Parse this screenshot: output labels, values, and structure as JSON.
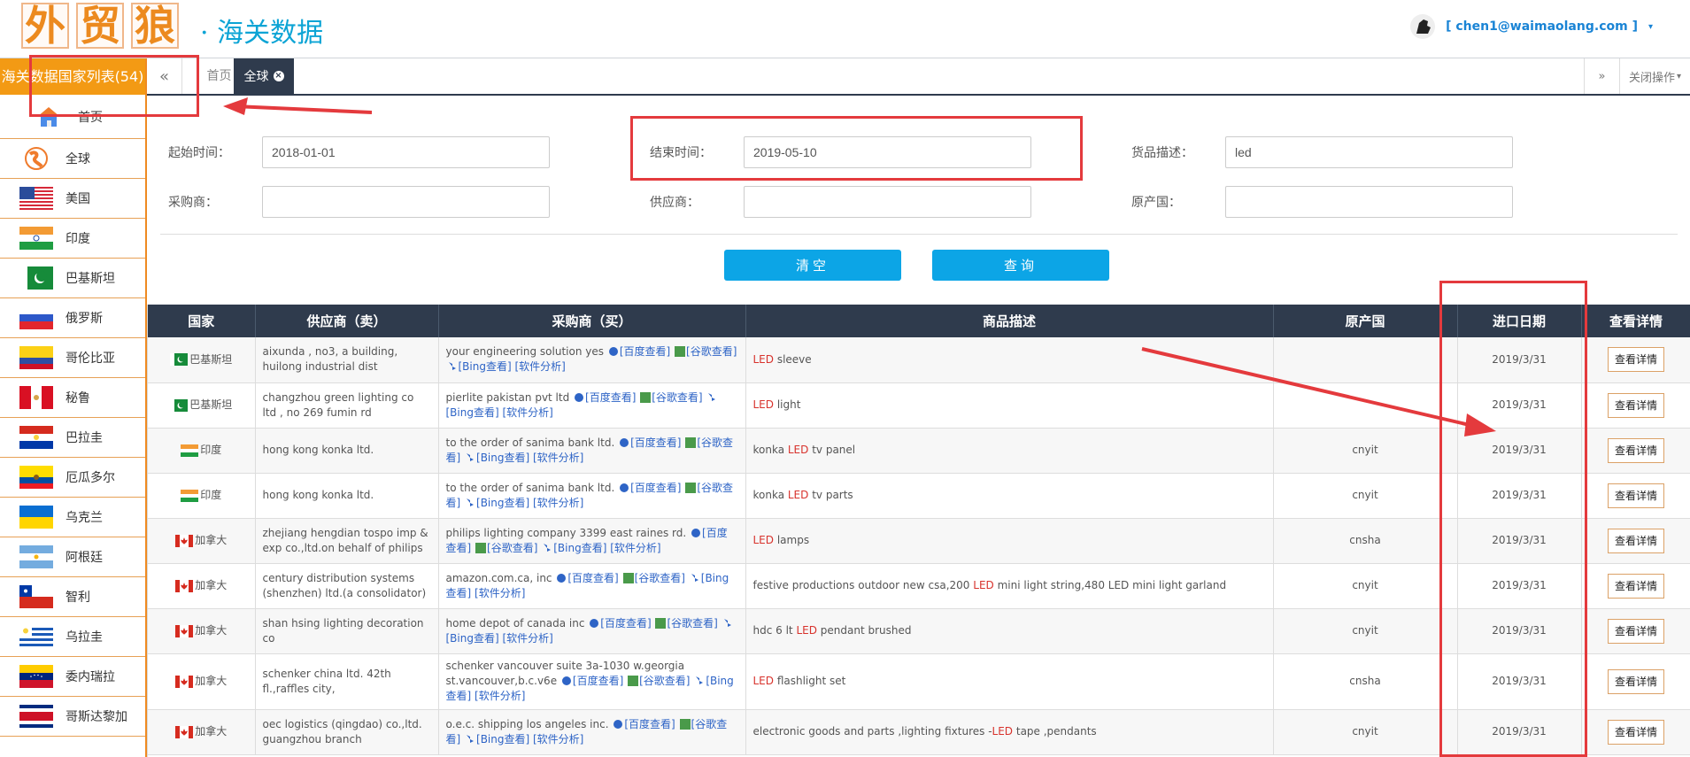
{
  "header": {
    "logo_chars": [
      "外",
      "贸",
      "狼"
    ],
    "brand": "· 海关数据",
    "user": "[ chen1@waimaolang.com ]"
  },
  "sidebar": {
    "title": "海关数据国家列表(54)",
    "home": "首页",
    "items": [
      {
        "label": "全球",
        "icon": "globe-icon"
      },
      {
        "label": "美国",
        "icon": "flag-usa-icon"
      },
      {
        "label": "印度",
        "icon": "flag-india-icon"
      },
      {
        "label": "巴基斯坦",
        "icon": "flag-pakistan-icon"
      },
      {
        "label": "俄罗斯",
        "icon": "flag-russia-icon"
      },
      {
        "label": "哥伦比亚",
        "icon": "flag-colombia-icon"
      },
      {
        "label": "秘鲁",
        "icon": "flag-peru-icon"
      },
      {
        "label": "巴拉圭",
        "icon": "flag-paraguay-icon"
      },
      {
        "label": "厄瓜多尔",
        "icon": "flag-ecuador-icon"
      },
      {
        "label": "乌克兰",
        "icon": "flag-ukraine-icon"
      },
      {
        "label": "阿根廷",
        "icon": "flag-argentina-icon"
      },
      {
        "label": "智利",
        "icon": "flag-chile-icon"
      },
      {
        "label": "乌拉圭",
        "icon": "flag-uruguay-icon"
      },
      {
        "label": "委内瑞拉",
        "icon": "flag-venezuela-icon"
      },
      {
        "label": "哥斯达黎加",
        "icon": "flag-costa-rica-icon"
      }
    ]
  },
  "tabs": {
    "home": "首页",
    "global": "全球",
    "close_ops": "关闭操作"
  },
  "form": {
    "start_label": "起始时间：",
    "start_value": "2018-01-01",
    "end_label": "结束时间：",
    "end_value": "2019-05-10",
    "desc_label": "货品描述：",
    "desc_value": "led",
    "buyer_label": "采购商：",
    "supplier_label": "供应商：",
    "origin_label": "原产国：",
    "clear": "清空",
    "search": "查询"
  },
  "table": {
    "headers": [
      "国家",
      "供应商（卖）",
      "采购商（买）",
      "商品描述",
      "原产国",
      "进口日期",
      "查看详情"
    ],
    "rows": [
      {
        "country": "巴基斯坦",
        "flag": "pk",
        "supplier": "aixunda , no3, a building, huilong industrial dist",
        "buyer": "your engineering solution yes",
        "desc_pre": "",
        "desc_led": "LED",
        "desc_post": " sleeve",
        "origin": "",
        "date": "2019/3/31"
      },
      {
        "country": "巴基斯坦",
        "flag": "pk",
        "supplier": "changzhou green lighting co ltd , no 269 fumin rd",
        "buyer": "pierlite pakistan pvt ltd",
        "desc_pre": "",
        "desc_led": "LED",
        "desc_post": " light",
        "origin": "",
        "date": "2019/3/31"
      },
      {
        "country": "印度",
        "flag": "in",
        "supplier": "hong kong konka ltd.",
        "buyer": "to the order of sanima bank ltd.",
        "desc_pre": "konka ",
        "desc_led": "LED",
        "desc_post": " tv panel",
        "origin": "cnyit",
        "date": "2019/3/31"
      },
      {
        "country": "印度",
        "flag": "in",
        "supplier": "hong kong konka ltd.",
        "buyer": "to the order of sanima bank ltd.",
        "desc_pre": "konka ",
        "desc_led": "LED",
        "desc_post": " tv parts",
        "origin": "cnyit",
        "date": "2019/3/31"
      },
      {
        "country": "加拿大",
        "flag": "ca",
        "supplier": "zhejiang hengdian tospo imp & exp co.,ltd.on behalf of philips",
        "buyer": "philips lighting company 3399 east raines rd.",
        "desc_pre": "",
        "desc_led": "LED",
        "desc_post": " lamps",
        "origin": "cnsha",
        "date": "2019/3/31"
      },
      {
        "country": "加拿大",
        "flag": "ca",
        "supplier": "century distribution systems (shenzhen) ltd.(a consolidator)",
        "buyer": "amazon.com.ca, inc",
        "desc_pre": "festive productions outdoor new csa,200 ",
        "desc_led": "LED",
        "desc_post": " mini light string,480 LED mini light garland",
        "origin": "cnyit",
        "date": "2019/3/31"
      },
      {
        "country": "加拿大",
        "flag": "ca",
        "supplier": "shan hsing lighting decoration co",
        "buyer": "home depot of canada inc",
        "desc_pre": "hdc 6 lt ",
        "desc_led": "LED",
        "desc_post": " pendant brushed",
        "origin": "cnyit",
        "date": "2019/3/31"
      },
      {
        "country": "加拿大",
        "flag": "ca",
        "supplier": "schenker china ltd. 42th fl.,raffles city,",
        "buyer": "schenker vancouver suite 3a-1030 w.georgia st.vancouver,b.c.v6e",
        "desc_pre": "",
        "desc_led": "LED",
        "desc_post": " flashlight set",
        "origin": "cnsha",
        "date": "2019/3/31"
      },
      {
        "country": "加拿大",
        "flag": "ca",
        "supplier": "oec logistics (qingdao) co.,ltd. guangzhou branch",
        "buyer": "o.e.c. shipping los angeles inc.",
        "desc_pre": "electronic goods and parts ,lighting fixtures -",
        "desc_led": "LED",
        "desc_post": " tape ,pendants",
        "origin": "cnyit",
        "date": "2019/3/31"
      }
    ],
    "links": [
      "[百度查看]",
      "[谷歌查看]",
      "[Bing查看]",
      "[软件分析]"
    ],
    "detail": "查看详情"
  },
  "colors": {
    "orange": "#f39a14",
    "blue": "#0ca4d5",
    "dark": "#2f3b4d",
    "red": "#e43a3d"
  }
}
